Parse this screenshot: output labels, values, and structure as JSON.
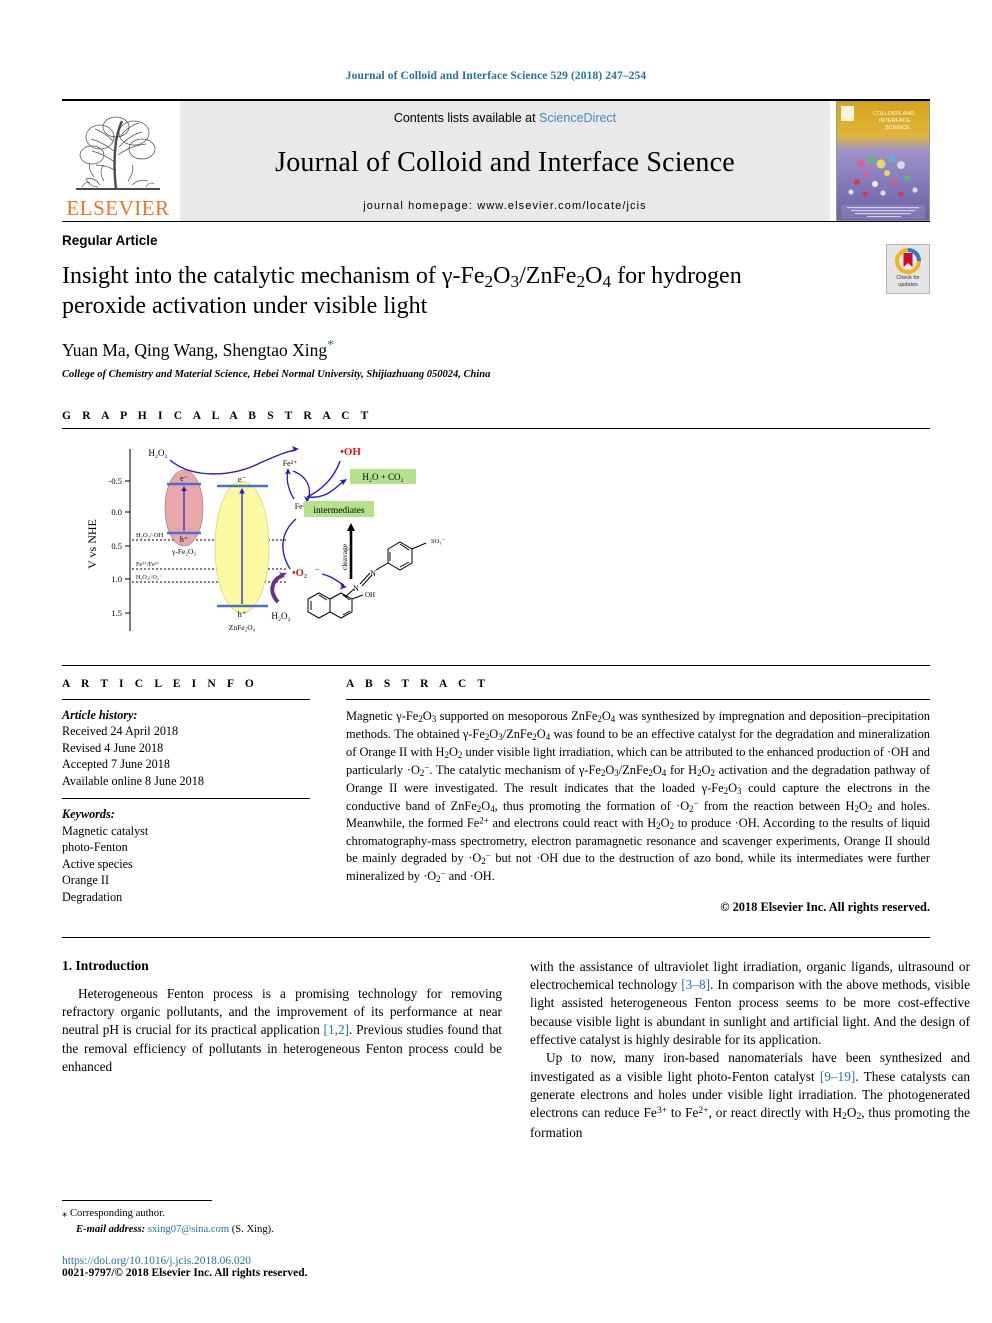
{
  "running_head": "Journal of Colloid and Interface Science 529 (2018) 247–254",
  "masthead": {
    "contents_prefix": "Contents lists available at ",
    "contents_link": "ScienceDirect",
    "journal_name": "Journal of Colloid and Interface Science",
    "homepage": "journal homepage: www.elsevier.com/locate/jcis",
    "publisher": "ELSEVIER",
    "cover_title_line1": "COLLOIDS AND",
    "cover_title_line2": "INTERFACE",
    "cover_title_line3": "SCIENCE"
  },
  "article": {
    "type": "Regular Article",
    "title": "Insight into the catalytic mechanism of γ-Fe2O3/ZnFe2O4 for hydrogen peroxide activation under visible light",
    "authors": "Yuan Ma, Qing Wang, Shengtao Xing",
    "corresponding_marker": "*",
    "affiliation": "College of Chemistry and Material Science, Hebei Normal University, Shijiazhuang 050024, China",
    "crossmark_label_line1": "Check for",
    "crossmark_label_line2": "updates"
  },
  "sections": {
    "graphical_abstract": "G R A P H I C A L   A B S T R A C T",
    "article_info": "A R T I C L E   I N F O",
    "abstract": "A B S T R A C T"
  },
  "graphical_abstract": {
    "y_axis_label": "V vs NHE",
    "y_ticks": [
      "-0.5",
      "0.0",
      "0.5",
      "1.0",
      "1.5"
    ],
    "potential_levels": [
      "H2O2/·OH",
      "Fe3+/Fe2+",
      "H2O2/·O2−"
    ],
    "species": {
      "left_oval": "γ-Fe2O3",
      "right_oval": "ZnFe2O4",
      "electron": "e−",
      "hole": "h+",
      "h2o2_top": "H2O2",
      "h2o2_bottom": "H2O2",
      "fe2": "Fe2+",
      "fe3": "Fe3+",
      "oh_radical": "•OH",
      "superoxide": "•O2−",
      "mineralization": "H2O + CO2",
      "intermediates": "intermediates",
      "cleavage": "cleavage",
      "sulfonate": "SO3−",
      "hydroxyl_label": "OH",
      "azo_n1": "N",
      "azo_n2": "N"
    },
    "colors": {
      "left_oval": "#e8a8a8",
      "right_oval": "#fbfaa0",
      "arrow_blue": "#1f1fd0",
      "arrow_purple": "#6a2f8e",
      "radical_red": "#e8131a",
      "highlight_green": "#b5e08c"
    }
  },
  "article_info": {
    "history_label": "Article history:",
    "history": [
      "Received 24 April 2018",
      "Revised 4 June 2018",
      "Accepted 7 June 2018",
      "Available online 8 June 2018"
    ],
    "keywords_label": "Keywords:",
    "keywords": [
      "Magnetic catalyst",
      "photo-Fenton",
      "Active species",
      "Orange II",
      "Degradation"
    ]
  },
  "abstract": {
    "text": "Magnetic γ-Fe2O3 supported on mesoporous ZnFe2O4 was synthesized by impregnation and deposition–precipitation methods. The obtained γ-Fe2O3/ZnFe2O4 was found to be an effective catalyst for the degradation and mineralization of Orange II with H2O2 under visible light irradiation, which can be attributed to the enhanced production of ·OH and particularly ·O2−. The catalytic mechanism of γ-Fe2O3/ZnFe2O4 for H2O2 activation and the degradation pathway of Orange II were investigated. The result indicates that the loaded γ-Fe2O3 could capture the electrons in the conductive band of ZnFe2O4, thus promoting the formation of ·O2− from the reaction between H2O2 and holes. Meanwhile, the formed Fe2+ and electrons could react with H2O2 to produce ·OH. According to the results of liquid chromatography-mass spectrometry, electron paramagnetic resonance and scavenger experiments, Orange II should be mainly degraded by ·O2− but not ·OH due to the destruction of azo bond, while its intermediates were further mineralized by ·O2− and ·OH.",
    "copyright": "© 2018 Elsevier Inc. All rights reserved."
  },
  "body": {
    "heading": "1. Introduction",
    "left_paragraphs": [
      "Heterogeneous Fenton process is a promising technology for removing refractory organic pollutants, and the improvement of its performance at near neutral pH is crucial for its practical application [1,2]. Previous studies found that the removal efficiency of pollutants in heterogeneous Fenton process could be enhanced"
    ],
    "right_paragraphs": [
      "with the assistance of ultraviolet light irradiation, organic ligands, ultrasound or electrochemical technology [3–8]. In comparison with the above methods, visible light assisted heterogeneous Fenton process seems to be more cost-effective because visible light is abundant in sunlight and artificial light. And the design of effective catalyst is highly desirable for its application.",
      "Up to now, many iron-based nanomaterials have been synthesized and investigated as a visible light photo-Fenton catalyst [9–19]. These catalysts can generate electrons and holes under visible light irradiation. The photogenerated electrons can reduce Fe3+ to Fe2+, or react directly with H2O2, thus promoting the formation"
    ],
    "citations": {
      "c1": "[1,2]",
      "c2": "[3–8]",
      "c3": "[9–19]"
    }
  },
  "footer": {
    "corresponding_marker": "⁎",
    "corresponding_text": "Corresponding author.",
    "email_label": "E-mail address:",
    "email": "sxing07@sina.com",
    "email_owner": "(S. Xing).",
    "doi": "https://doi.org/10.1016/j.jcis.2018.06.020",
    "issn_copyright": "0021-9797/© 2018 Elsevier Inc. All rights reserved."
  }
}
